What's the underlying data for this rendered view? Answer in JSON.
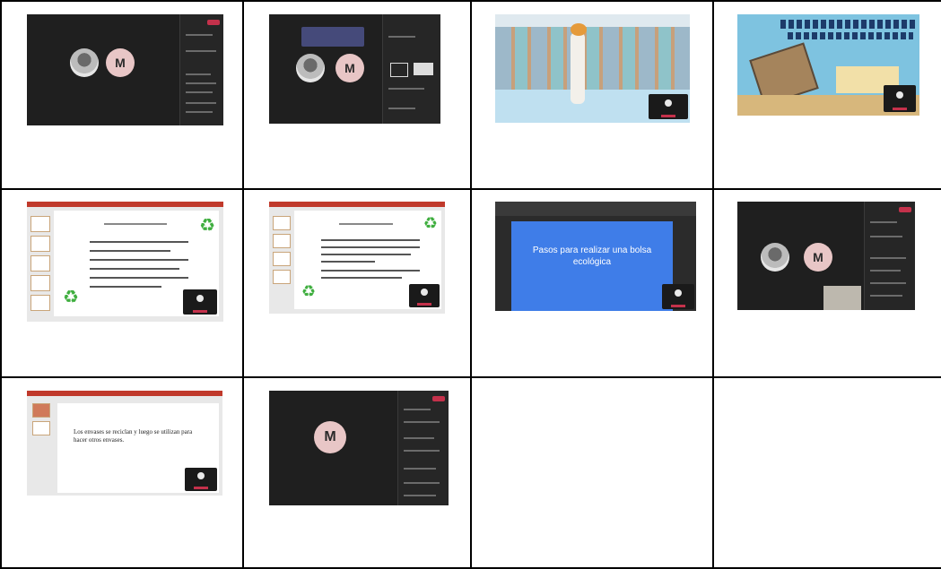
{
  "grid": {
    "rows": 3,
    "columns": 4
  },
  "cells": [
    {
      "id": 1,
      "description_kind": "teams-call-two-participants",
      "avatar_letter": "M"
    },
    {
      "id": 2,
      "description_kind": "teams-call-with-settings-popup",
      "avatar_letter": "M"
    },
    {
      "id": 3,
      "description_kind": "cartoon-supermarket-video"
    },
    {
      "id": 4,
      "description_kind": "cartoon-truck-video"
    },
    {
      "id": 5,
      "description_kind": "ppt-slide-recycling"
    },
    {
      "id": 6,
      "description_kind": "ppt-slide-recycling-text"
    },
    {
      "id": 7,
      "description_kind": "blue-slide",
      "slide_text": "Pasos para realizar una bolsa ecológica"
    },
    {
      "id": 8,
      "description_kind": "teams-call-with-video",
      "avatar_letter": "M"
    },
    {
      "id": 9,
      "description_kind": "ppt-slide-text",
      "slide_text": "Los envases se reciclan y luego se utilizan para hacer otros envases."
    },
    {
      "id": 10,
      "description_kind": "teams-call-one-participant",
      "avatar_letter": "M"
    },
    {
      "id": 11,
      "description_kind": "empty"
    },
    {
      "id": 12,
      "description_kind": "empty"
    }
  ],
  "colors": {
    "teams_dark": "#1f1f1f",
    "avatar_pink": "#e8c6c6",
    "end_call_red": "#c4314b",
    "slide_blue": "#3f7de8",
    "recycle_green": "#3fae3f"
  }
}
